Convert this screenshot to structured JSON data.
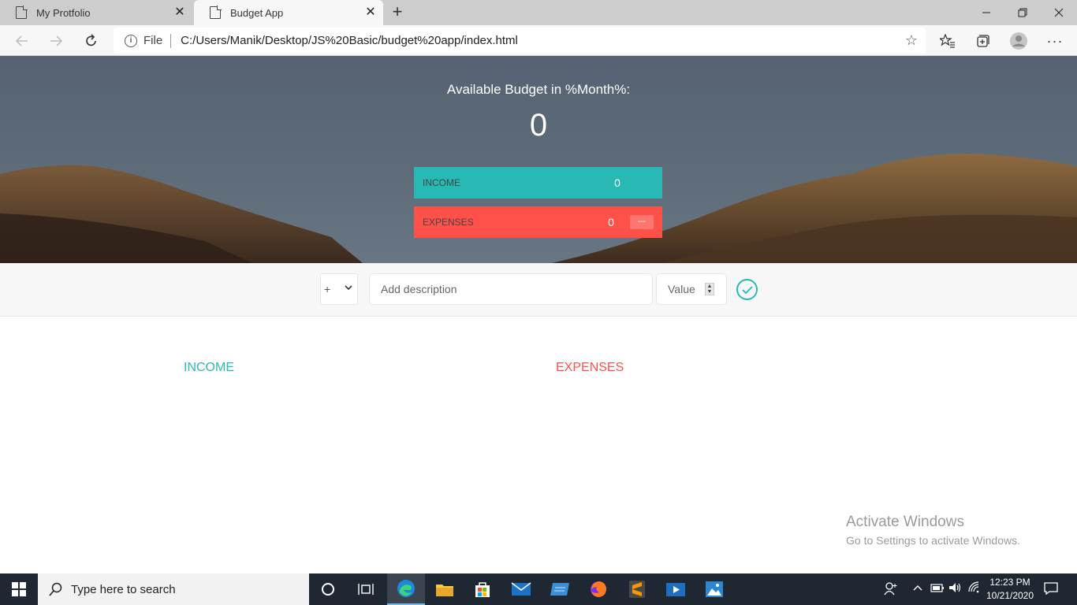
{
  "browser": {
    "tabs": [
      {
        "title": "My Protfolio",
        "active": false
      },
      {
        "title": "Budget App",
        "active": true
      }
    ],
    "address": {
      "scheme_label": "File",
      "url": "C:/Users/Manik/Desktop/JS%20Basic/budget%20app/index.html"
    }
  },
  "budget": {
    "title": "Available Budget in %Month%:",
    "value": "0",
    "income_label": "Income",
    "income_value": "0",
    "expenses_label": "Expenses",
    "expenses_value": "0",
    "expenses_percentage": "---"
  },
  "add_form": {
    "type_selected": "+",
    "description_placeholder": "Add description",
    "value_placeholder": "Value"
  },
  "lists": {
    "income_title": "Income",
    "expenses_title": "Expenses"
  },
  "watermark": {
    "line1": "Activate Windows",
    "line2": "Go to Settings to activate Windows."
  },
  "taskbar": {
    "search_placeholder": "Type here to search",
    "time": "12:23 PM",
    "date": "10/21/2020"
  },
  "colors": {
    "income": "#28b9b5",
    "expense": "#ff5049"
  }
}
